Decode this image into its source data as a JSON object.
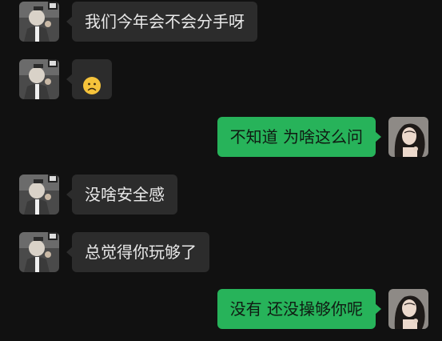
{
  "colors": {
    "background": "#111111",
    "incoming_bubble": "#2c2c2c",
    "outgoing_bubble": "#27b35a"
  },
  "messages": [
    {
      "side": "left",
      "text": "我们今年会不会分手呀"
    },
    {
      "side": "left",
      "emoji": "worried-face-icon"
    },
    {
      "side": "right",
      "text": "不知道 为啥这么问"
    },
    {
      "side": "left",
      "text": "没啥安全感"
    },
    {
      "side": "left",
      "text": "总觉得你玩够了"
    },
    {
      "side": "right",
      "text": "没有 还没操够你呢"
    }
  ]
}
